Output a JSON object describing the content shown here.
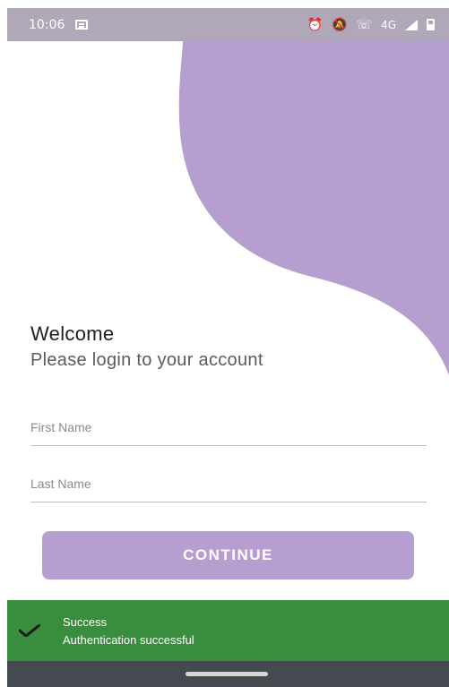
{
  "status_bar": {
    "time": "10:06",
    "network_label": "4G",
    "network_label_secondary": "4G",
    "icons": [
      "news-icon",
      "alarm-icon",
      "mute-icon",
      "call-signal-icon",
      "signal-icon",
      "battery-icon"
    ]
  },
  "header": {
    "title": "Welcome",
    "subtitle": "Please login to your account"
  },
  "form": {
    "first_name_placeholder": "First Name",
    "first_name_value": "",
    "last_name_placeholder": "Last Name",
    "last_name_value": "",
    "continue_label": "CONTINUE"
  },
  "snackbar": {
    "title": "Success",
    "message": "Authentication successful",
    "icon": "check-icon"
  },
  "colors": {
    "accent": "#b79ed0",
    "status_bar": "#b0a8b8",
    "success": "#388e3c",
    "nav_bar": "#454a50"
  }
}
